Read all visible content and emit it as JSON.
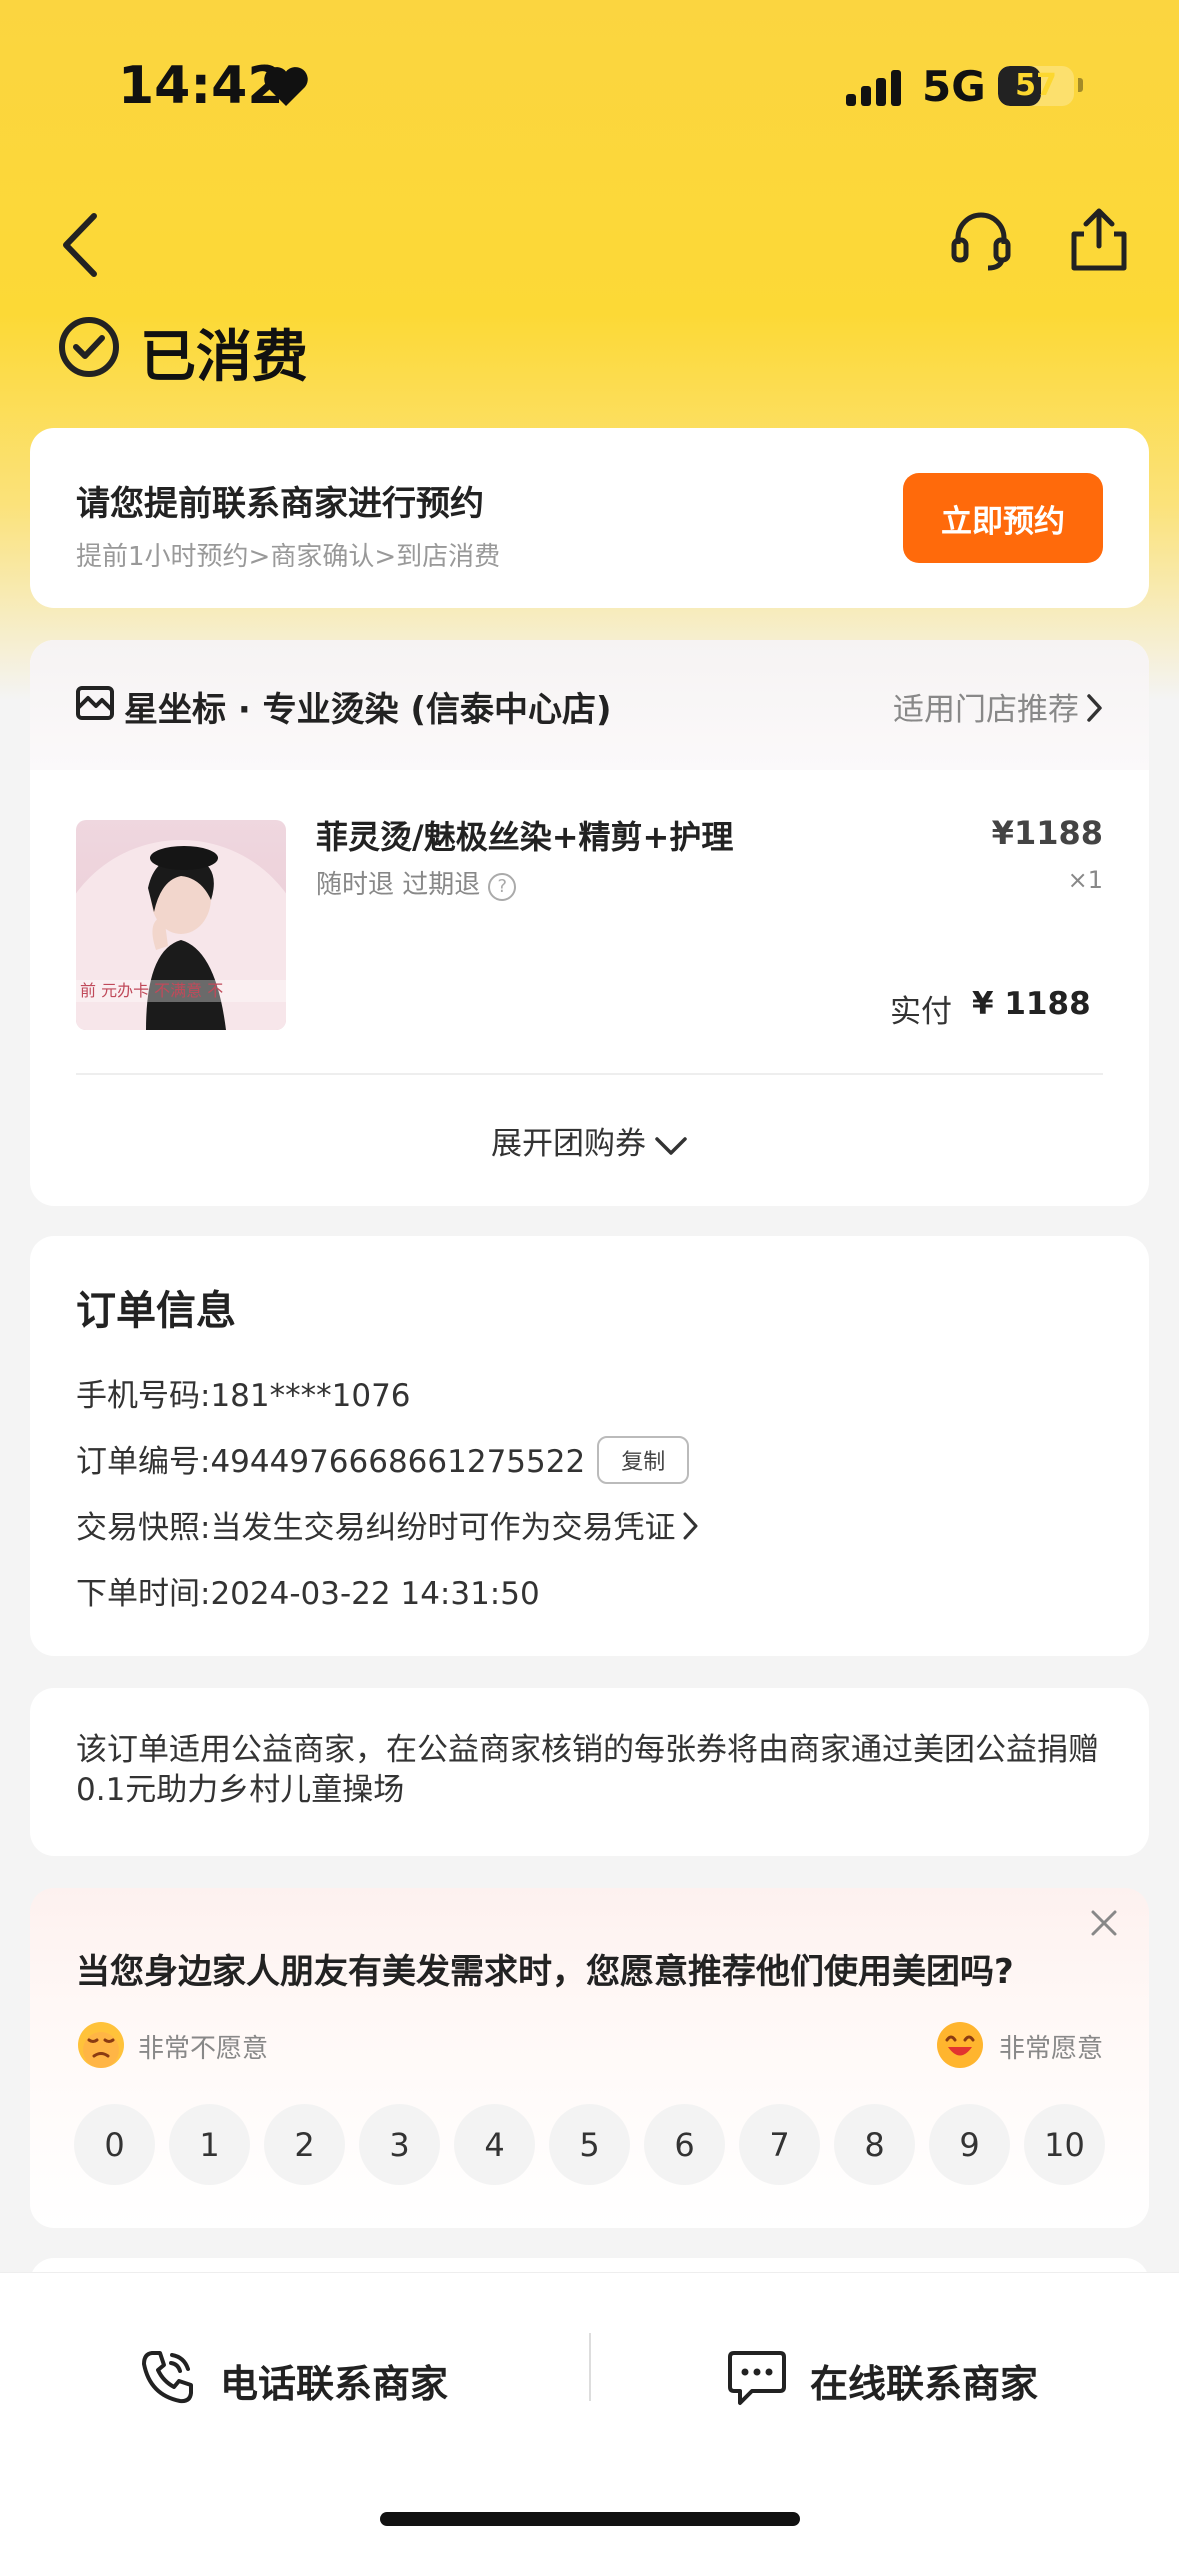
{
  "status_bar": {
    "time": "14:42",
    "network": "5G",
    "battery": "57",
    "battery_level": 57
  },
  "header": {
    "status_title": "已消费"
  },
  "reserve": {
    "title": "请您提前联系商家进行预约",
    "subtitle": "提前1小时预约>商家确认>到店消费",
    "button": "立即预约"
  },
  "shop": {
    "name": "星坐标 · 专业烫染 (信泰中心店)",
    "link": "适用门店推荐"
  },
  "product": {
    "name": "菲灵烫/魅极丝染+精剪+护理",
    "refund": "随时退 过期退",
    "price": "¥1188",
    "qty": "×1",
    "paid_label": "实付",
    "paid_amount": "¥ 1188",
    "image_overlay": "前 元办卡 不满意 不"
  },
  "expand_label": "展开团购券",
  "order": {
    "title": "订单信息",
    "phone_label": "手机号码:",
    "phone": "181****1076",
    "order_no_label": "订单编号:",
    "order_no": "4944976668661275522",
    "copy": "复制",
    "snapshot_label": "交易快照:",
    "snapshot": "当发生交易纠纷时可作为交易凭证",
    "time_label": "下单时间:",
    "time": "2024-03-22 14:31:50"
  },
  "charity": {
    "text": "该订单适用公益商家，在公益商家核销的每张券将由商家通过美团公益捐赠 0.1元助力乡村儿童操场"
  },
  "survey": {
    "question": "当您身边家人朋友有美发需求时，您愿意推荐他们使用美团吗?",
    "low_label": "非常不愿意",
    "high_label": "非常愿意",
    "scores": [
      "0",
      "1",
      "2",
      "3",
      "4",
      "5",
      "6",
      "7",
      "8",
      "9",
      "10"
    ]
  },
  "bottom": {
    "phone": "电话联系商家",
    "online": "在线联系商家"
  },
  "colors": {
    "brand_yellow": "#fcd72f",
    "accent_orange": "#ff6a0b"
  }
}
